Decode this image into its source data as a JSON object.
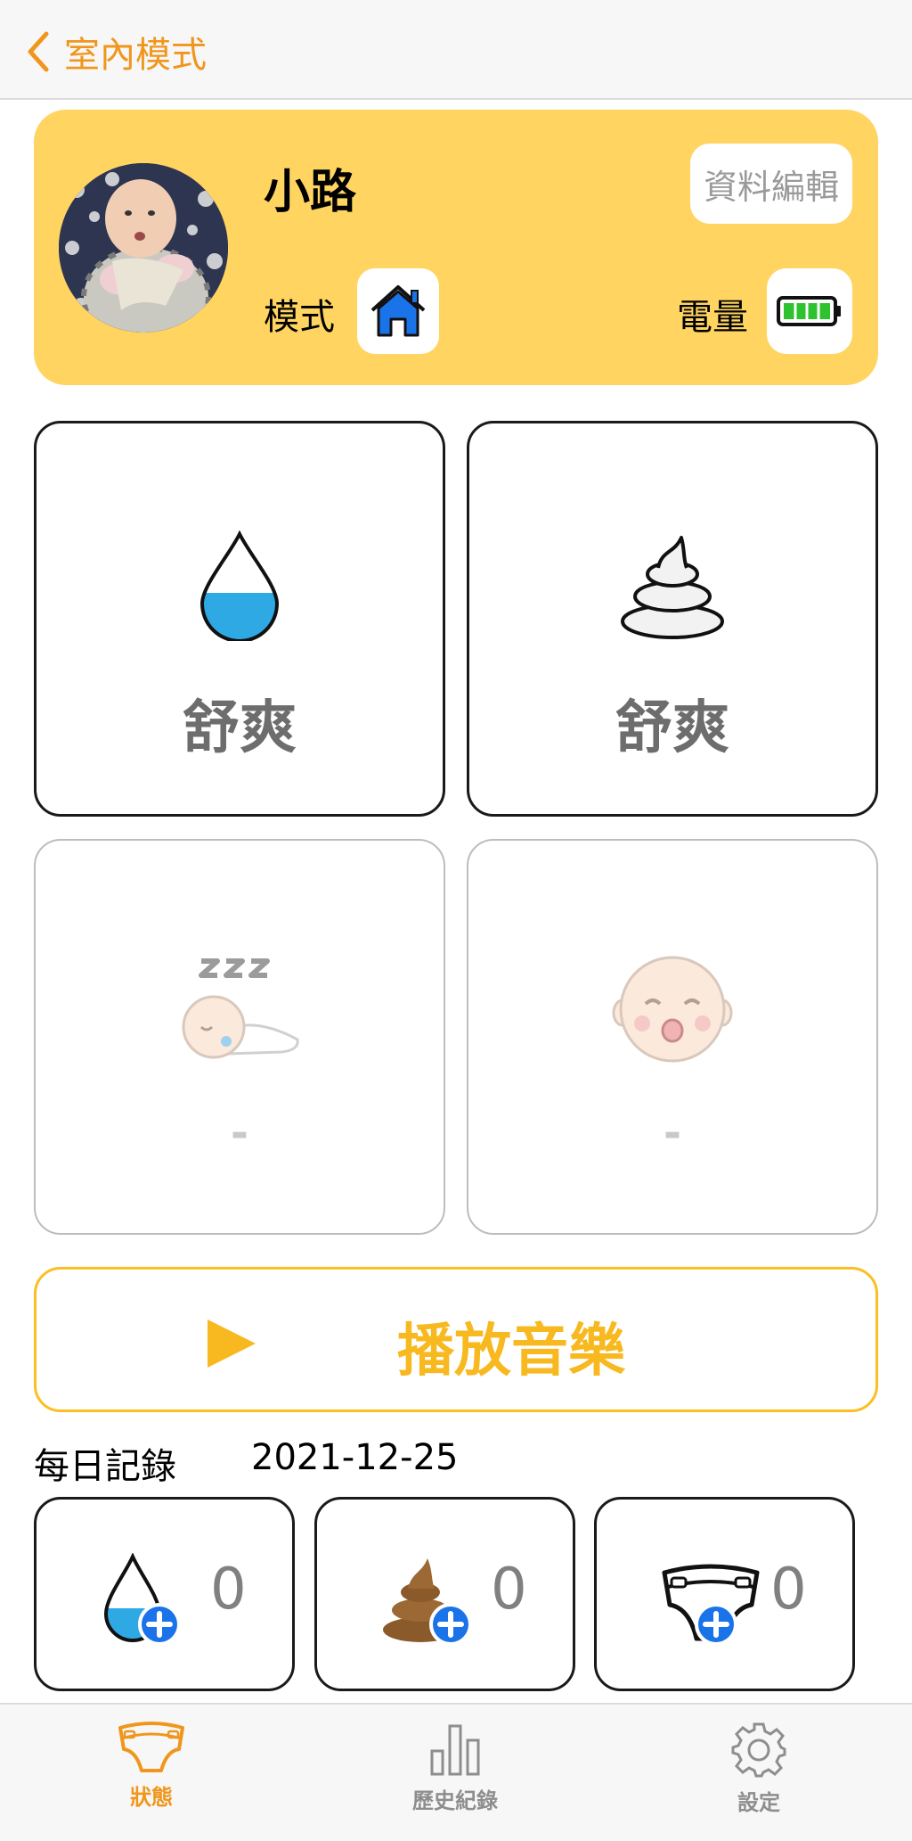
{
  "nav": {
    "back_label": "室內模式"
  },
  "profile": {
    "name": "小路",
    "edit_label": "資料編輯",
    "mode_label": "模式",
    "battery_label": "電量",
    "mode_icon": "home-icon",
    "battery_level": 1.0
  },
  "status_cards": [
    {
      "icon": "urine-drop-icon",
      "status": "舒爽"
    },
    {
      "icon": "poop-icon",
      "status": "舒爽"
    },
    {
      "icon": "sleeping-baby-icon",
      "status": "-"
    },
    {
      "icon": "crying-baby-icon",
      "status": "-"
    }
  ],
  "music": {
    "label": "播放音樂"
  },
  "daily": {
    "label": "每日記錄",
    "date": "2021-12-25",
    "counters": [
      {
        "icon": "urine-drop-add-icon",
        "count": "0"
      },
      {
        "icon": "poop-add-icon",
        "count": "0"
      },
      {
        "icon": "diaper-add-icon",
        "count": "0"
      }
    ]
  },
  "tabs": [
    {
      "label": "狀態",
      "icon": "diaper-icon",
      "active": true
    },
    {
      "label": "歷史紀錄",
      "icon": "bar-chart-icon",
      "active": false
    },
    {
      "label": "設定",
      "icon": "gear-icon",
      "active": false
    }
  ],
  "colors": {
    "accent": "#f0961c",
    "card_bg": "#ffd461",
    "music": "#f7b91f",
    "water": "#2ea9e4",
    "poop": "#8a5a2b"
  }
}
